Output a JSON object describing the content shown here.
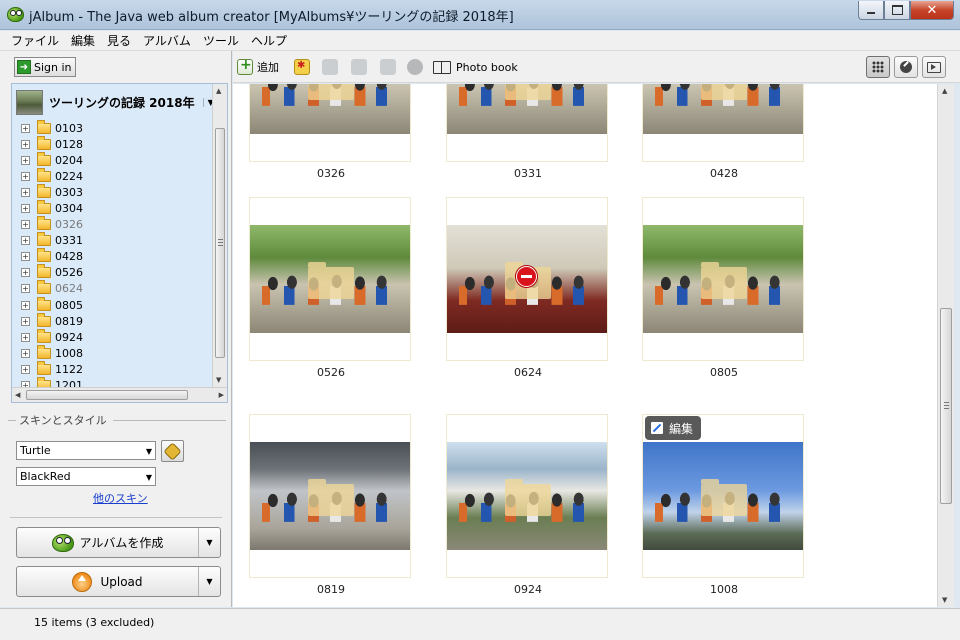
{
  "window": {
    "title": "jAlbum - The Java web album creator [MyAlbums¥ツーリングの記録 2018年]",
    "icon": "jalbum-frog-icon"
  },
  "menu": [
    "ファイル",
    "編集",
    "見る",
    "アルバム",
    "ツール",
    "ヘルプ"
  ],
  "sidebar": {
    "signin_label": "Sign in",
    "album_title": "ツーリングの記録 2018年",
    "folders": [
      {
        "name": "0103",
        "excluded": false
      },
      {
        "name": "0128",
        "excluded": false
      },
      {
        "name": "0204",
        "excluded": false
      },
      {
        "name": "0224",
        "excluded": false
      },
      {
        "name": "0303",
        "excluded": false
      },
      {
        "name": "0304",
        "excluded": false
      },
      {
        "name": "0326",
        "excluded": true
      },
      {
        "name": "0331",
        "excluded": false
      },
      {
        "name": "0428",
        "excluded": false
      },
      {
        "name": "0526",
        "excluded": false
      },
      {
        "name": "0624",
        "excluded": true
      },
      {
        "name": "0805",
        "excluded": false
      },
      {
        "name": "0819",
        "excluded": false
      },
      {
        "name": "0924",
        "excluded": false
      },
      {
        "name": "1008",
        "excluded": false
      },
      {
        "name": "1122",
        "excluded": false
      },
      {
        "name": "1201",
        "excluded": false
      }
    ],
    "skin_section_label": "スキンとスタイル",
    "skin_value": "Turtle",
    "style_value": "BlackRed",
    "other_skins_link": "他のスキン",
    "make_album_label": "アルバムを作成",
    "upload_label": "Upload"
  },
  "toolbar": {
    "add_label": "追加",
    "photobook_label": "Photo book",
    "active_view": "thumbnail-grid"
  },
  "thumbnails": [
    {
      "name": "0326",
      "scene": "outdoor",
      "excluded": false
    },
    {
      "name": "0331",
      "scene": "outdoor",
      "excluded": false
    },
    {
      "name": "0428",
      "scene": "outdoor",
      "excluded": false
    },
    {
      "name": "0526",
      "scene": "outdoor",
      "excluded": false
    },
    {
      "name": "0624",
      "scene": "indoor",
      "excluded": true
    },
    {
      "name": "0805",
      "scene": "outdoor",
      "excluded": false
    },
    {
      "name": "0819",
      "scene": "track",
      "excluded": false
    },
    {
      "name": "0924",
      "scene": "school",
      "excluded": false
    },
    {
      "name": "1008",
      "scene": "sky",
      "excluded": false,
      "hovered": true
    }
  ],
  "edit_badge_label": "編集",
  "status": {
    "text": "15 items (3 excluded)"
  },
  "colors": {
    "accent": "#d9141d",
    "tree_bg": "#dbeaf8",
    "link": "#1a3fcc"
  }
}
